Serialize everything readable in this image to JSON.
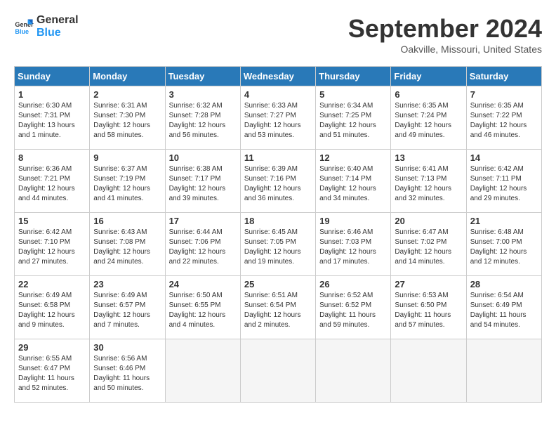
{
  "header": {
    "logo_line1": "General",
    "logo_line2": "Blue",
    "month": "September 2024",
    "location": "Oakville, Missouri, United States"
  },
  "weekdays": [
    "Sunday",
    "Monday",
    "Tuesday",
    "Wednesday",
    "Thursday",
    "Friday",
    "Saturday"
  ],
  "weeks": [
    [
      {
        "day": "1",
        "detail": "Sunrise: 6:30 AM\nSunset: 7:31 PM\nDaylight: 13 hours\nand 1 minute."
      },
      {
        "day": "2",
        "detail": "Sunrise: 6:31 AM\nSunset: 7:30 PM\nDaylight: 12 hours\nand 58 minutes."
      },
      {
        "day": "3",
        "detail": "Sunrise: 6:32 AM\nSunset: 7:28 PM\nDaylight: 12 hours\nand 56 minutes."
      },
      {
        "day": "4",
        "detail": "Sunrise: 6:33 AM\nSunset: 7:27 PM\nDaylight: 12 hours\nand 53 minutes."
      },
      {
        "day": "5",
        "detail": "Sunrise: 6:34 AM\nSunset: 7:25 PM\nDaylight: 12 hours\nand 51 minutes."
      },
      {
        "day": "6",
        "detail": "Sunrise: 6:35 AM\nSunset: 7:24 PM\nDaylight: 12 hours\nand 49 minutes."
      },
      {
        "day": "7",
        "detail": "Sunrise: 6:35 AM\nSunset: 7:22 PM\nDaylight: 12 hours\nand 46 minutes."
      }
    ],
    [
      {
        "day": "8",
        "detail": "Sunrise: 6:36 AM\nSunset: 7:21 PM\nDaylight: 12 hours\nand 44 minutes."
      },
      {
        "day": "9",
        "detail": "Sunrise: 6:37 AM\nSunset: 7:19 PM\nDaylight: 12 hours\nand 41 minutes."
      },
      {
        "day": "10",
        "detail": "Sunrise: 6:38 AM\nSunset: 7:17 PM\nDaylight: 12 hours\nand 39 minutes."
      },
      {
        "day": "11",
        "detail": "Sunrise: 6:39 AM\nSunset: 7:16 PM\nDaylight: 12 hours\nand 36 minutes."
      },
      {
        "day": "12",
        "detail": "Sunrise: 6:40 AM\nSunset: 7:14 PM\nDaylight: 12 hours\nand 34 minutes."
      },
      {
        "day": "13",
        "detail": "Sunrise: 6:41 AM\nSunset: 7:13 PM\nDaylight: 12 hours\nand 32 minutes."
      },
      {
        "day": "14",
        "detail": "Sunrise: 6:42 AM\nSunset: 7:11 PM\nDaylight: 12 hours\nand 29 minutes."
      }
    ],
    [
      {
        "day": "15",
        "detail": "Sunrise: 6:42 AM\nSunset: 7:10 PM\nDaylight: 12 hours\nand 27 minutes."
      },
      {
        "day": "16",
        "detail": "Sunrise: 6:43 AM\nSunset: 7:08 PM\nDaylight: 12 hours\nand 24 minutes."
      },
      {
        "day": "17",
        "detail": "Sunrise: 6:44 AM\nSunset: 7:06 PM\nDaylight: 12 hours\nand 22 minutes."
      },
      {
        "day": "18",
        "detail": "Sunrise: 6:45 AM\nSunset: 7:05 PM\nDaylight: 12 hours\nand 19 minutes."
      },
      {
        "day": "19",
        "detail": "Sunrise: 6:46 AM\nSunset: 7:03 PM\nDaylight: 12 hours\nand 17 minutes."
      },
      {
        "day": "20",
        "detail": "Sunrise: 6:47 AM\nSunset: 7:02 PM\nDaylight: 12 hours\nand 14 minutes."
      },
      {
        "day": "21",
        "detail": "Sunrise: 6:48 AM\nSunset: 7:00 PM\nDaylight: 12 hours\nand 12 minutes."
      }
    ],
    [
      {
        "day": "22",
        "detail": "Sunrise: 6:49 AM\nSunset: 6:58 PM\nDaylight: 12 hours\nand 9 minutes."
      },
      {
        "day": "23",
        "detail": "Sunrise: 6:49 AM\nSunset: 6:57 PM\nDaylight: 12 hours\nand 7 minutes."
      },
      {
        "day": "24",
        "detail": "Sunrise: 6:50 AM\nSunset: 6:55 PM\nDaylight: 12 hours\nand 4 minutes."
      },
      {
        "day": "25",
        "detail": "Sunrise: 6:51 AM\nSunset: 6:54 PM\nDaylight: 12 hours\nand 2 minutes."
      },
      {
        "day": "26",
        "detail": "Sunrise: 6:52 AM\nSunset: 6:52 PM\nDaylight: 11 hours\nand 59 minutes."
      },
      {
        "day": "27",
        "detail": "Sunrise: 6:53 AM\nSunset: 6:50 PM\nDaylight: 11 hours\nand 57 minutes."
      },
      {
        "day": "28",
        "detail": "Sunrise: 6:54 AM\nSunset: 6:49 PM\nDaylight: 11 hours\nand 54 minutes."
      }
    ],
    [
      {
        "day": "29",
        "detail": "Sunrise: 6:55 AM\nSunset: 6:47 PM\nDaylight: 11 hours\nand 52 minutes."
      },
      {
        "day": "30",
        "detail": "Sunrise: 6:56 AM\nSunset: 6:46 PM\nDaylight: 11 hours\nand 50 minutes."
      },
      {
        "day": "",
        "detail": "",
        "empty": true
      },
      {
        "day": "",
        "detail": "",
        "empty": true
      },
      {
        "day": "",
        "detail": "",
        "empty": true
      },
      {
        "day": "",
        "detail": "",
        "empty": true
      },
      {
        "day": "",
        "detail": "",
        "empty": true
      }
    ]
  ]
}
